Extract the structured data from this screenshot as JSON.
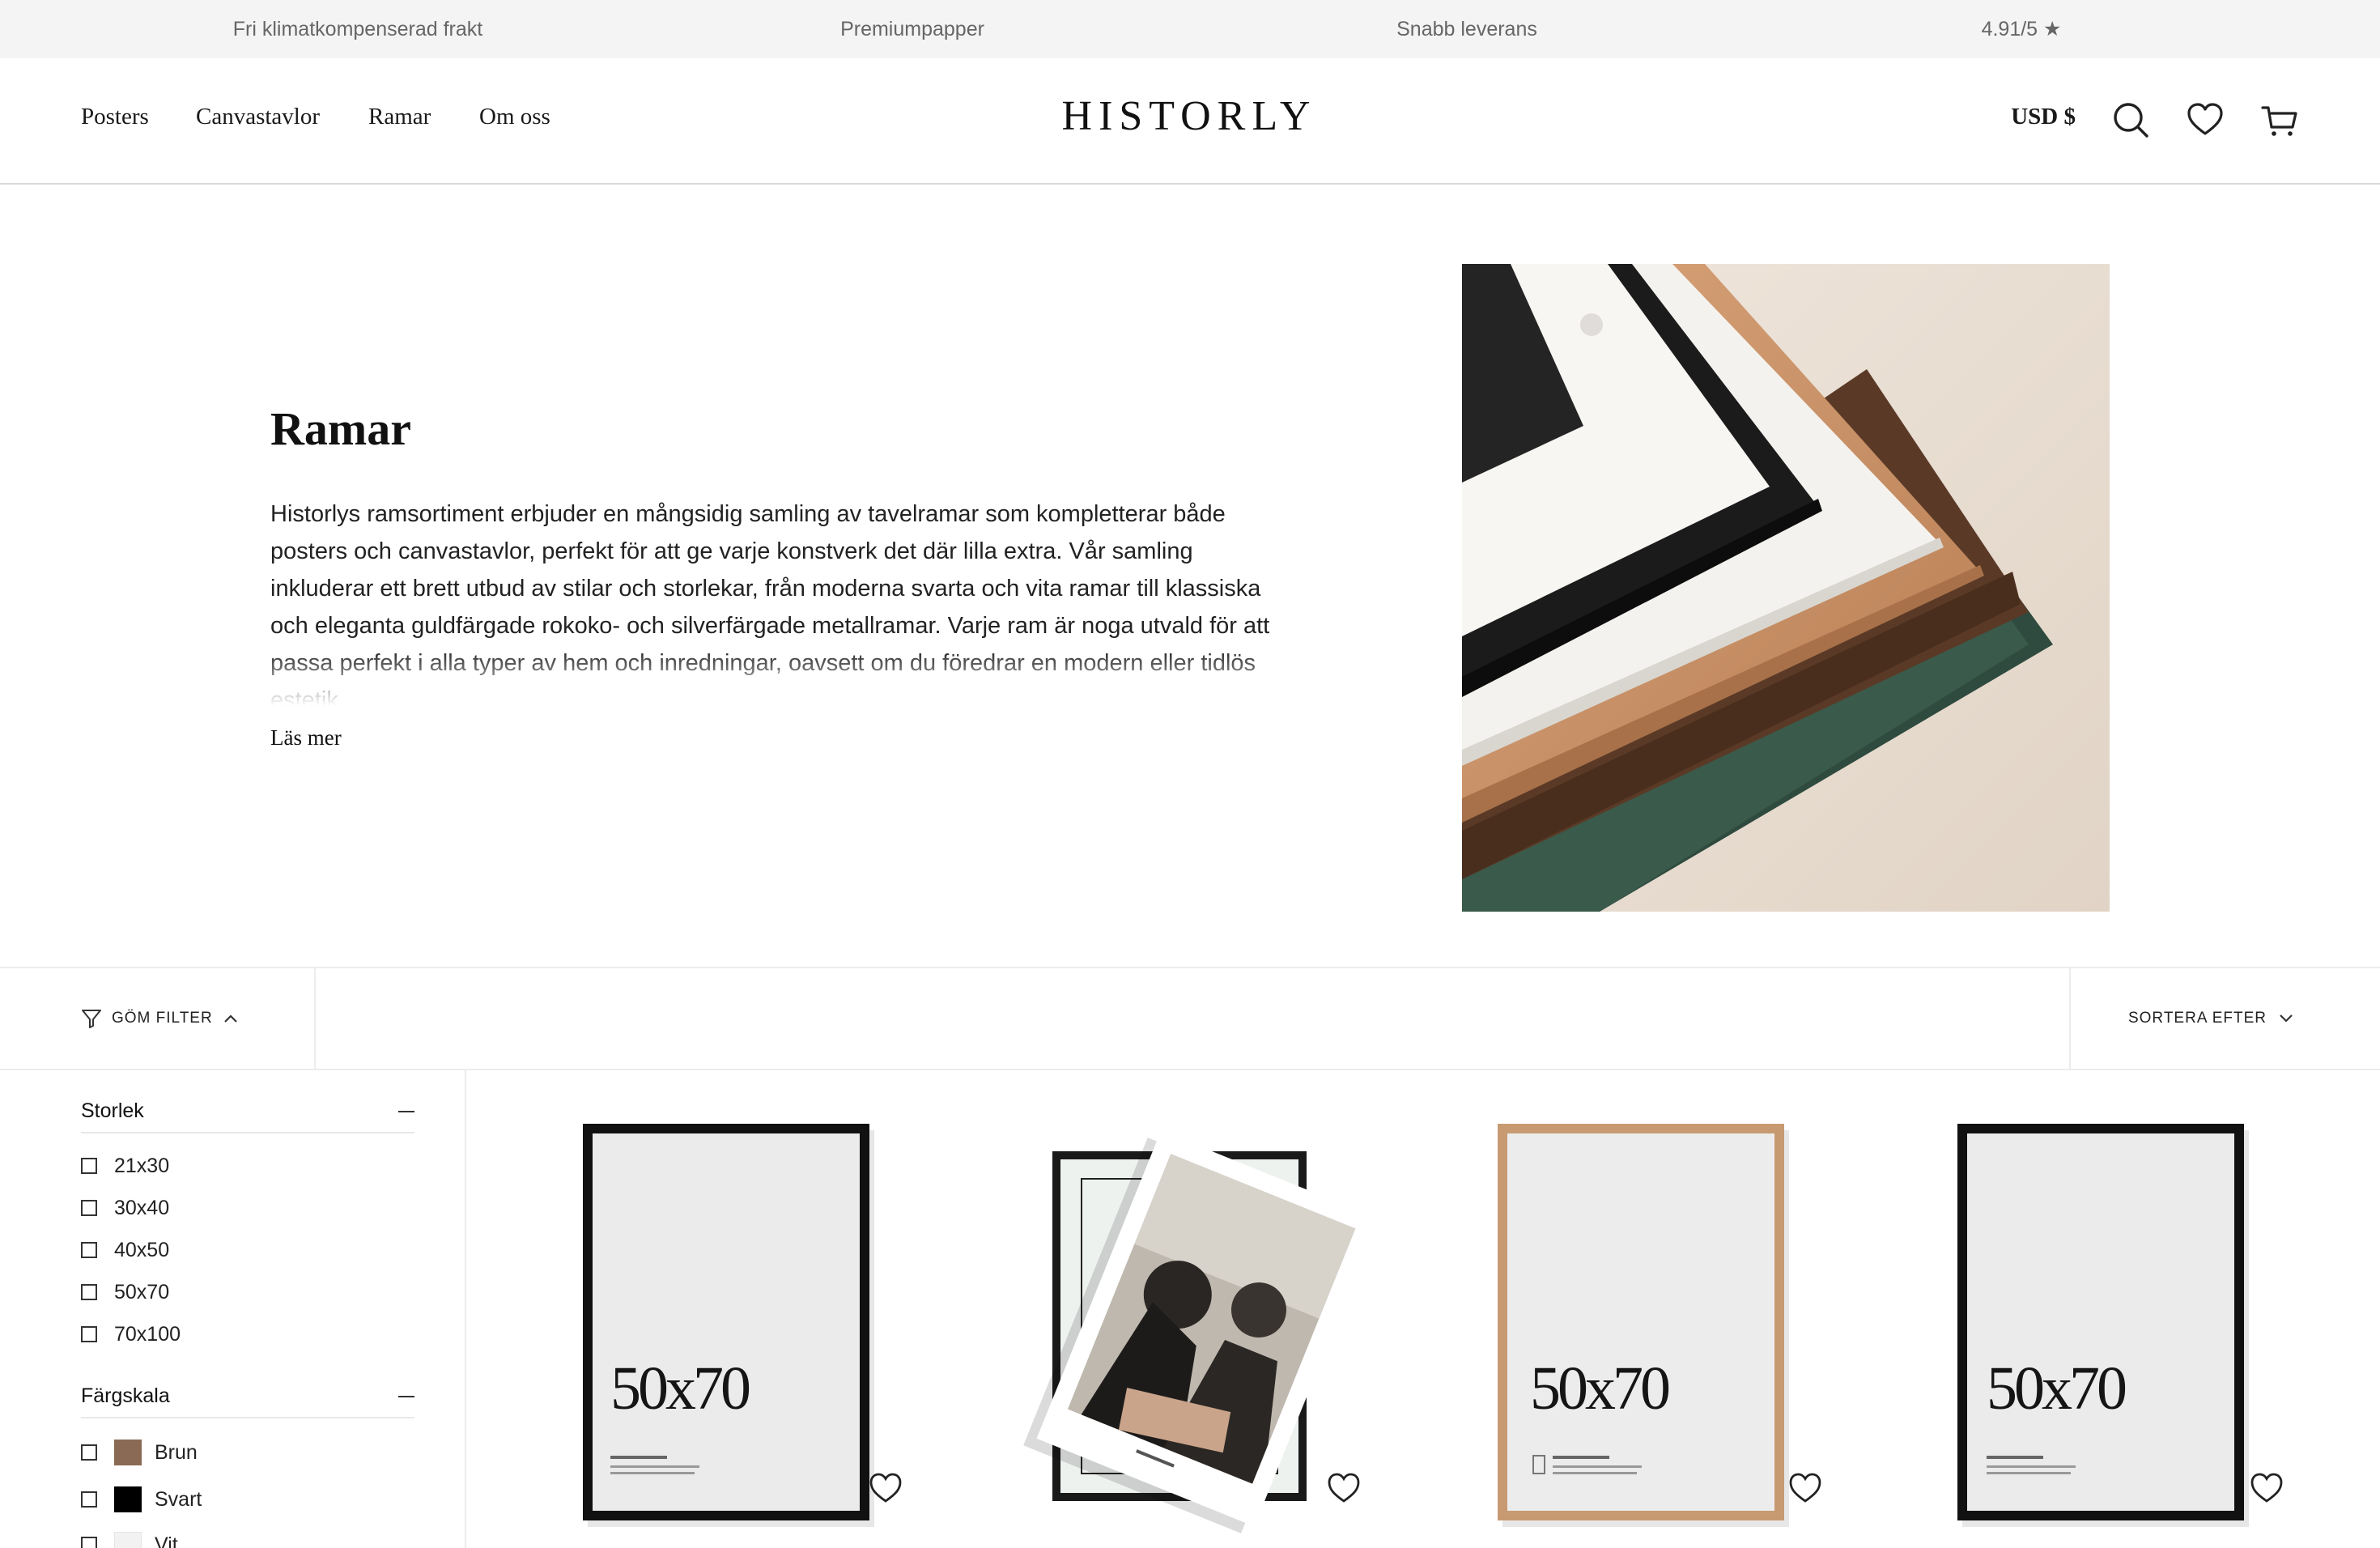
{
  "announcement": {
    "items": [
      "Fri klimatkompenserad frakt",
      "Premiumpapper",
      "Snabb leverans",
      "4.91/5 ★"
    ]
  },
  "header": {
    "nav": [
      "Posters",
      "Canvastavlor",
      "Ramar",
      "Om oss"
    ],
    "logo": "HISTORLY",
    "currency": "USD $",
    "icons": [
      "search-icon",
      "heart-icon",
      "cart-icon"
    ]
  },
  "hero": {
    "title": "Ramar",
    "description": "Historlys ramsortiment erbjuder en mångsidig samling av tavelramar som kompletterar både posters och canvastavlor, perfekt för att ge varje konstverk det där lilla extra. Vår samling inkluderar ett brett utbud av stilar och storlekar, från moderna svarta och vita ramar till klassiska och eleganta guldfärgade rokoko- och silverfärgade metallramar. Varje ram är noga utvald för att passa perfekt i alla typer av hem och inredningar, oavsett om du föredrar en modern eller tidlös estetik.",
    "read_more": "Läs mer"
  },
  "toolbar": {
    "hide_filter": "GÖM FILTER",
    "sort": "SORTERA EFTER"
  },
  "filters": {
    "size": {
      "title": "Storlek",
      "options": [
        "21x30",
        "30x40",
        "40x50",
        "50x70",
        "70x100"
      ]
    },
    "color": {
      "title": "Färgskala",
      "options": [
        {
          "label": "Brun",
          "color": "#8a6a55"
        },
        {
          "label": "Svart",
          "color": "#000000"
        },
        {
          "label": "Vit",
          "color": "#f2f2f2"
        }
      ]
    }
  },
  "products": [
    {
      "frame": "black",
      "size_label": "50x70",
      "frame_color": "#111111"
    },
    {
      "frame": "black-with-print",
      "frame_color": "#1a1a1a"
    },
    {
      "frame": "oak",
      "size_label": "50x70",
      "frame_color": "#c89a72"
    },
    {
      "frame": "black",
      "size_label": "50x70",
      "frame_color": "#111111"
    }
  ],
  "colors": {
    "announcement_bg": "#f4f4f4",
    "text": "#1a1a1a",
    "muted": "#666666",
    "divider": "#ececec"
  }
}
